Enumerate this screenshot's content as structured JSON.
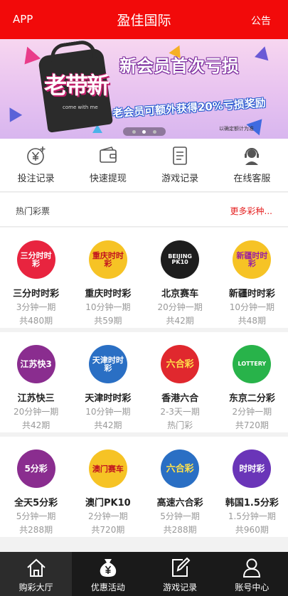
{
  "header": {
    "app_label": "APP",
    "title": "盈佳国际",
    "notice_label": "公告"
  },
  "banner": {
    "headline": "新会员首次亏损",
    "left_text": "老带新",
    "bag_text": "come with me",
    "subline": "老会员可额外获得20%亏损奖励",
    "small_text": "以确定额计为准",
    "slide_count": 3,
    "active_slide": 1
  },
  "actions": [
    {
      "label": "投注记录",
      "icon": "yen-plus-icon"
    },
    {
      "label": "快速提现",
      "icon": "wallet-icon"
    },
    {
      "label": "游戏记录",
      "icon": "document-icon"
    },
    {
      "label": "在线客服",
      "icon": "headset-icon"
    }
  ],
  "hot": {
    "title": "热门彩票",
    "more": "更多彩种..."
  },
  "lotteries": [
    {
      "name": "三分时时彩",
      "interval": "3分钟一期",
      "count": "共480期",
      "logo_text": "三分时时彩",
      "color": "#e8243f"
    },
    {
      "name": "重庆时时彩",
      "interval": "10分钟一期",
      "count": "共59期",
      "logo_text": "重庆时时彩",
      "color": "#f6c325"
    },
    {
      "name": "北京赛车",
      "interval": "20分钟一期",
      "count": "共42期",
      "logo_text": "BEIJING PK10",
      "color": "#1d1d1d"
    },
    {
      "name": "新疆时时彩",
      "interval": "10分钟一期",
      "count": "共48期",
      "logo_text": "新疆时时彩",
      "color": "#f6c325"
    },
    {
      "name": "江苏快三",
      "interval": "20分钟一期",
      "count": "共42期",
      "logo_text": "江苏快3",
      "color": "#8a2d8f"
    },
    {
      "name": "天津时时彩",
      "interval": "10分钟一期",
      "count": "共42期",
      "logo_text": "天津时时彩",
      "color": "#2a6fc4"
    },
    {
      "name": "香港六合",
      "interval": "2-3天一期",
      "count": "热门彩",
      "logo_text": "六合彩",
      "color": "#e0282e"
    },
    {
      "name": "东京二分彩",
      "interval": "2分钟一期",
      "count": "共720期",
      "logo_text": "LOTTERY",
      "color": "#28b34a"
    },
    {
      "name": "全天5分彩",
      "interval": "5分钟一期",
      "count": "共288期",
      "logo_text": "5分彩",
      "color": "#8a2d8f"
    },
    {
      "name": "澳门PK10",
      "interval": "2分钟一期",
      "count": "共720期",
      "logo_text": "澳门赛车",
      "color": "#f6c325"
    },
    {
      "name": "高速六合彩",
      "interval": "5分钟一期",
      "count": "共288期",
      "logo_text": "六合彩",
      "color": "#2a6fc4"
    },
    {
      "name": "韩国1.5分彩",
      "interval": "1.5分钟一期",
      "count": "共960期",
      "logo_text": "时时彩",
      "color": "#6a35b8"
    }
  ],
  "tabs": [
    {
      "label": "购彩大厅",
      "icon": "home-icon",
      "active": true
    },
    {
      "label": "优惠活动",
      "icon": "money-bag-icon",
      "active": false
    },
    {
      "label": "游戏记录",
      "icon": "edit-icon",
      "active": false
    },
    {
      "label": "账号中心",
      "icon": "user-icon",
      "active": false
    }
  ],
  "colors": {
    "brand_red": "#f20a0a",
    "more_link": "#e52020"
  }
}
